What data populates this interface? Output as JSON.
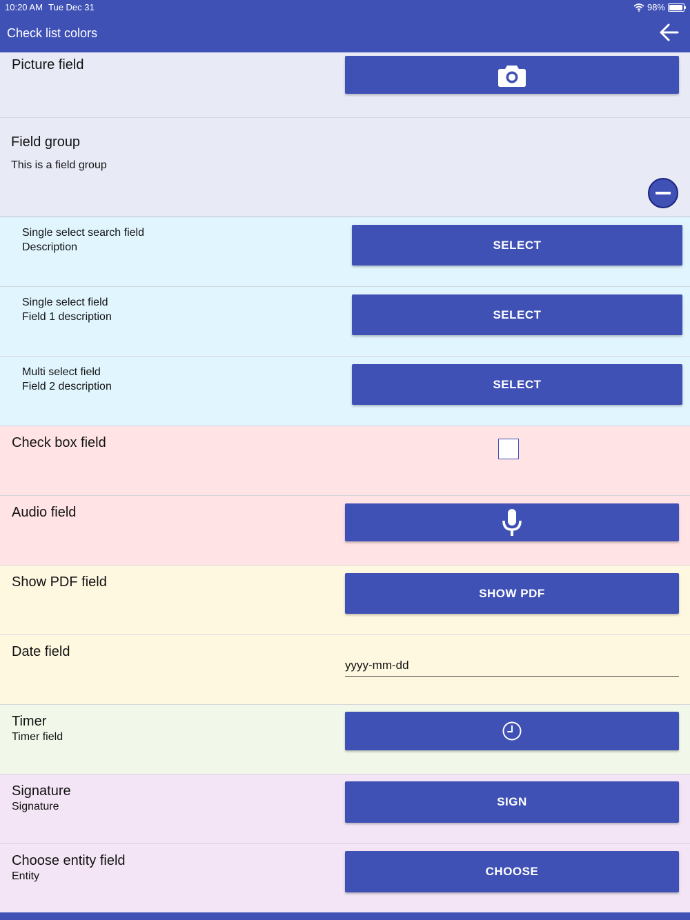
{
  "status_bar": {
    "time": "10:20 AM",
    "date": "Tue Dec 31",
    "battery": "98%"
  },
  "header": {
    "title": "Check list colors"
  },
  "fields": {
    "picture": {
      "label": "Picture field"
    },
    "group": {
      "label": "Field group",
      "description": "This is a field group"
    },
    "single_select_search": {
      "label": "Single select search field",
      "description": "Description",
      "button": "SELECT"
    },
    "single_select": {
      "label": "Single select field",
      "description": "Field 1 description",
      "button": "SELECT"
    },
    "multi_select": {
      "label": "Multi select field",
      "description": "Field 2 description",
      "button": "SELECT"
    },
    "checkbox": {
      "label": "Check box field",
      "checked": false
    },
    "audio": {
      "label": "Audio field"
    },
    "pdf": {
      "label": "Show PDF field",
      "button": "SHOW PDF"
    },
    "date": {
      "label": "Date field",
      "placeholder": "yyyy-mm-dd",
      "value": ""
    },
    "timer": {
      "label": "Timer",
      "description": "Timer field"
    },
    "signature": {
      "label": "Signature",
      "description": "Signature",
      "button": "SIGN"
    },
    "entity": {
      "label": "Choose entity field",
      "description": "Entity",
      "button": "CHOOSE"
    }
  },
  "colors": {
    "primary": "#3f51b5",
    "gray_row": "#e8eaf6",
    "blue_row": "#e1f5fe",
    "pink_row": "#ffe3e5",
    "yellow_row": "#fff8e1",
    "green_row": "#f1f8e9",
    "purple_row": "#f3e5f5"
  },
  "icons": [
    "wifi-icon",
    "battery-icon",
    "back-arrow-icon",
    "camera-icon",
    "minus-circle-icon",
    "microphone-icon",
    "clock-icon"
  ]
}
